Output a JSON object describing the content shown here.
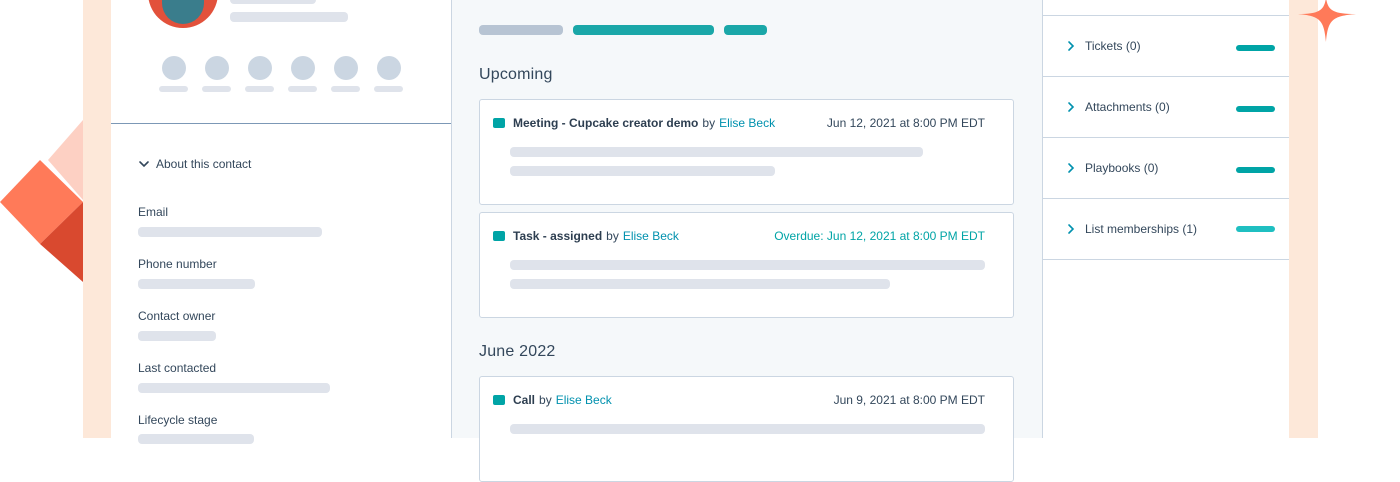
{
  "colors": {
    "accent": "#00a4a6",
    "link": "#0091ae",
    "placeholder": "#dfe3eb",
    "border": "#cbd6e2",
    "peach": "#fde8d9",
    "coral": "#ff7a59"
  },
  "left_panel": {
    "about_toggle_icon": "chevron-down-icon",
    "about_label": "About this contact",
    "properties": [
      {
        "label": "Email"
      },
      {
        "label": "Phone number"
      },
      {
        "label": "Contact owner"
      },
      {
        "label": "Last contacted"
      },
      {
        "label": "Lifecycle stage"
      }
    ]
  },
  "timeline": {
    "sections": [
      {
        "heading": "Upcoming",
        "activities": [
          {
            "icon": "meeting-icon",
            "title": "Meeting - Cupcake creator demo",
            "by": "by",
            "author": "Elise Beck",
            "date": "Jun 12, 2021 at 8:00 PM EDT",
            "overdue": false
          },
          {
            "icon": "task-icon",
            "title": "Task - assigned",
            "by": "by",
            "author": "Elise Beck",
            "date": "Overdue: Jun 12, 2021 at 8:00 PM EDT",
            "overdue": true
          }
        ]
      },
      {
        "heading": "June 2022",
        "activities": [
          {
            "icon": "call-icon",
            "title": "Call",
            "by": "by",
            "author": "Elise Beck",
            "date": "Jun 9, 2021 at 8:00 PM EDT",
            "overdue": false
          }
        ]
      }
    ]
  },
  "right_panel": {
    "sections": [
      {
        "label": "Tickets (0)",
        "icon": "chevron-right-icon"
      },
      {
        "label": "Attachments (0)",
        "icon": "chevron-right-icon"
      },
      {
        "label": "Playbooks (0)",
        "icon": "chevron-right-icon"
      },
      {
        "label": "List memberships (1)",
        "icon": "chevron-right-icon"
      }
    ]
  }
}
